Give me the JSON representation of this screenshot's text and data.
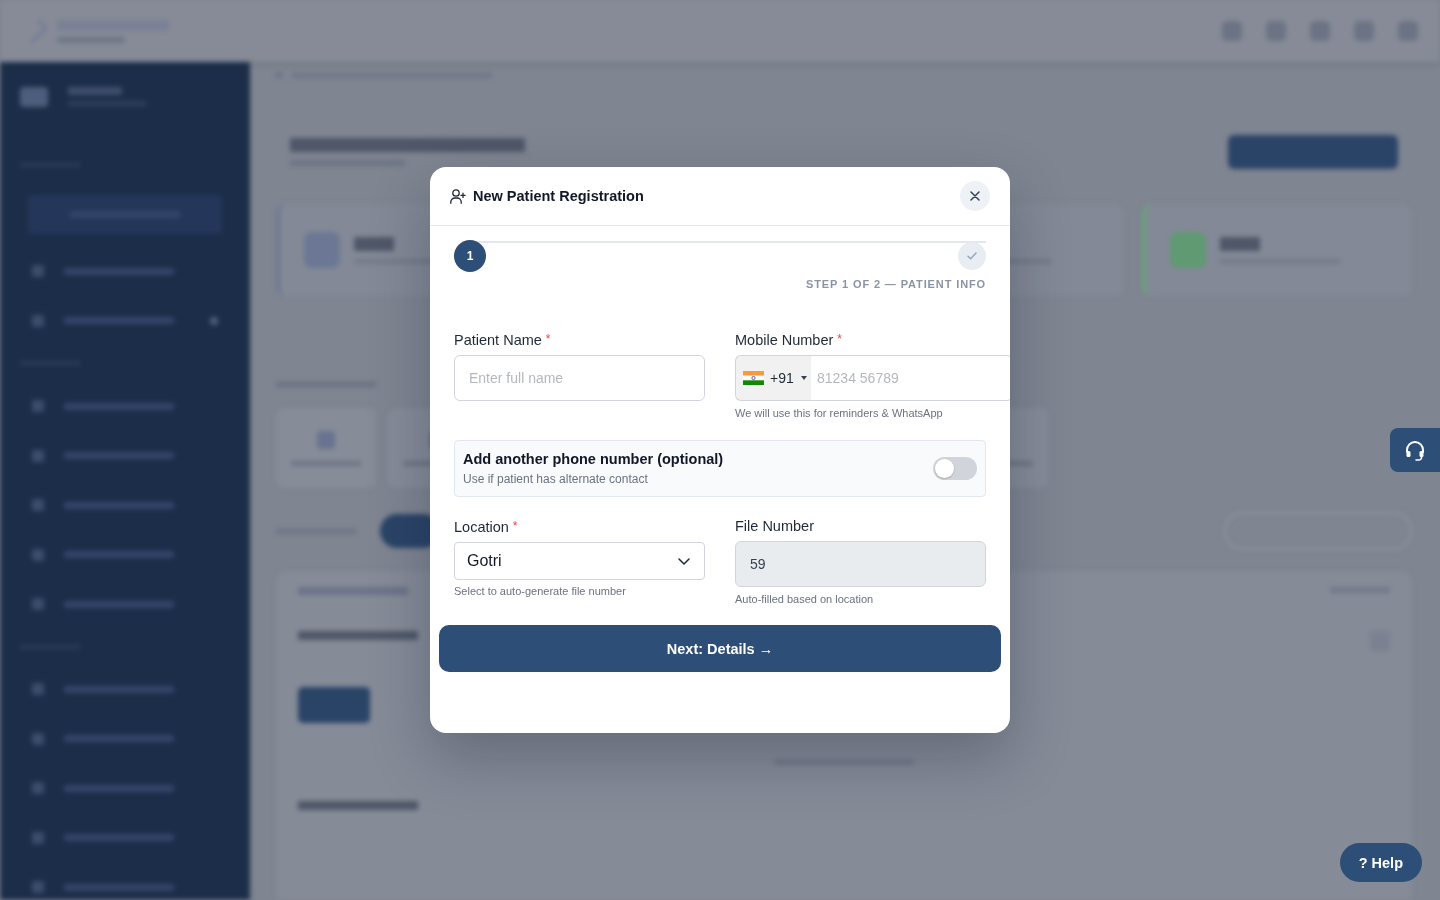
{
  "dialog": {
    "title": "New Patient Registration",
    "stepper": {
      "steps": [
        {
          "kind": "number",
          "text": "1",
          "selected": true
        },
        {
          "kind": "check",
          "selected": false
        }
      ],
      "caption": "STEP 1 OF 2 — PATIENT INFO"
    },
    "fields": [
      {
        "kind": "text",
        "label": "Patient Name",
        "required_mark": "*",
        "placeholder": "Enter full name",
        "disabled": false
      },
      {
        "kind": "phone",
        "label": "Mobile Number",
        "required_mark": "*",
        "country_code": "+91",
        "placeholder": "81234 56789",
        "hint": "We will use this for reminders & WhatsApp"
      },
      {
        "kind": "toggle",
        "title": "Add another phone number (optional)",
        "subtitle": "Use if patient has alternate contact",
        "on": false
      },
      {
        "kind": "select",
        "label": "Location",
        "required_mark": "*",
        "value": "Gotri",
        "hint": "Select to auto-generate file number"
      },
      {
        "kind": "text",
        "label": "File Number",
        "value": "59",
        "disabled": true,
        "hint": "Auto-filled based on location"
      }
    ],
    "next_button": "Next: Details →"
  },
  "help_button": "? Help"
}
